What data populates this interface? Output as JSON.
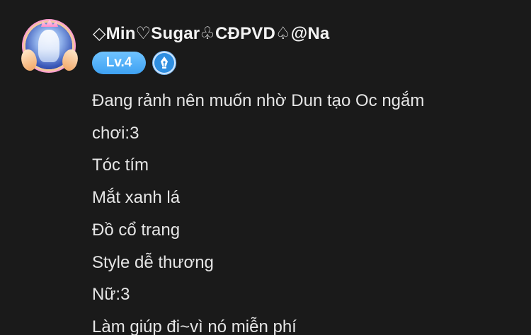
{
  "post": {
    "author": {
      "username": "◇Min♡Sugar♧CĐPVD♤@Na",
      "level_label": "Lv.4",
      "avatar_icon": "anime-avatar-with-wings-frame",
      "role_icon": "fountain-pen-icon"
    },
    "body_lines": [
      "Đang rảnh nên muốn nhờ Dun tạo Oc ngắm",
      "chơi:3",
      "Tóc tím",
      "Mắt xanh lá",
      "Đồ cổ trang",
      "Style dễ thương",
      "Nữ:3",
      "Làm giúp đi~vì nó miễn phí"
    ]
  },
  "colors": {
    "background": "#1a1a1a",
    "text": "#e6e6e6",
    "level_badge": "#3ea1f2",
    "pen_badge": "#2f8ee0"
  }
}
